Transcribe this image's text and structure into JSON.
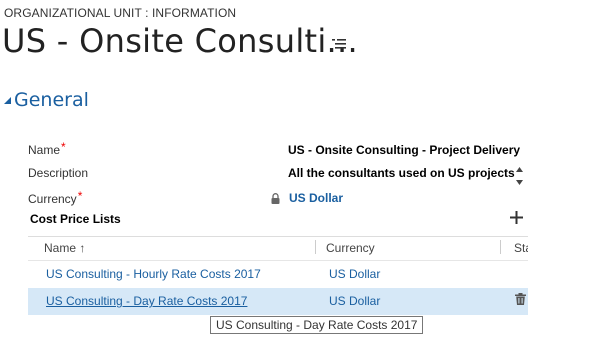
{
  "header": {
    "entity_label": "ORGANIZATIONAL UNIT : INFORMATION",
    "record_title": "US - Onsite Consulti..."
  },
  "section": {
    "title": "General"
  },
  "fields": {
    "name_label": "Name",
    "name_value": "US - Onsite Consulting - Project Delivery",
    "description_label": "Description",
    "description_value": "All the consultants used on US projects",
    "currency_label": "Currency",
    "currency_value": "US Dollar",
    "required_marker": "*"
  },
  "subgrid": {
    "title": "Cost Price Lists",
    "columns": [
      "Name",
      "Currency",
      "Sta"
    ],
    "sort_indicator": "↑",
    "rows": [
      {
        "name": "US Consulting - Hourly Rate Costs 2017",
        "currency": "US Dollar"
      },
      {
        "name": "US Consulting - Day Rate Costs 2017",
        "currency": "US Dollar"
      }
    ]
  },
  "tooltip": {
    "text": "US Consulting - Day Rate Costs 2017"
  },
  "icons": {
    "menu": "menu-list-icon",
    "collapse": "collapse-triangle-icon",
    "lock": "lock-icon",
    "add": "plus-icon",
    "delete": "trash-icon",
    "spin": "spin-up-down-icon"
  },
  "colors": {
    "accent": "#1a5fa0",
    "required": "#e00000",
    "selected_row": "#d6e8f7",
    "hover_row": "#e8f2fb"
  }
}
